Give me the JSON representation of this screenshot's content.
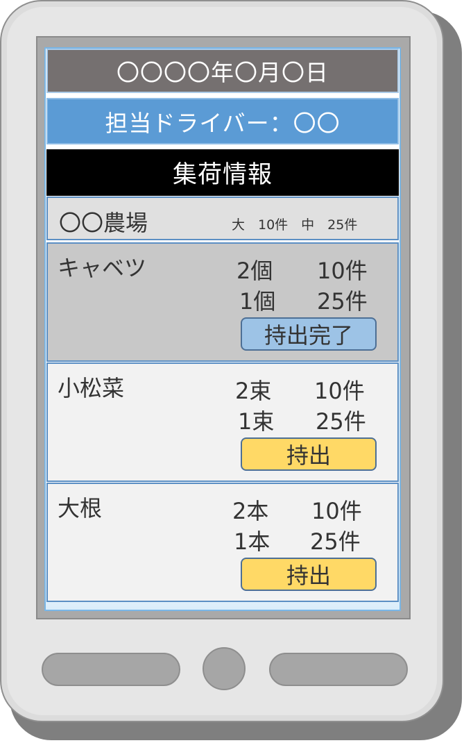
{
  "header": {
    "date": "〇〇〇〇年〇月〇日",
    "driver": "担当ドライバー：〇〇",
    "section_title": "集荷情報"
  },
  "farm": {
    "name": "〇〇農場",
    "summary": "大　10件　中　25件"
  },
  "items": [
    {
      "name": "キャベツ",
      "rows": [
        {
          "qty": "2個",
          "count": "10件"
        },
        {
          "qty": "1個",
          "count": "25件"
        }
      ],
      "button_label": "持出完了",
      "status": "done"
    },
    {
      "name": "小松菜",
      "rows": [
        {
          "qty": "2束",
          "count": "10件"
        },
        {
          "qty": "1束",
          "count": "25件"
        }
      ],
      "button_label": "持出",
      "status": "pending"
    },
    {
      "name": "大根",
      "rows": [
        {
          "qty": "2本",
          "count": "10件"
        },
        {
          "qty": "1本",
          "count": "25件"
        }
      ],
      "button_label": "持出",
      "status": "pending"
    }
  ],
  "colors": {
    "date_bar": "#757070",
    "driver_bar": "#5b9bd5",
    "section_bar": "#000000",
    "done_button": "#9dc3e6",
    "pending_button": "#ffd966"
  },
  "icons": {
    "home_button": "home-button-icon",
    "left_key": "left-key-icon",
    "right_key": "right-key-icon"
  }
}
